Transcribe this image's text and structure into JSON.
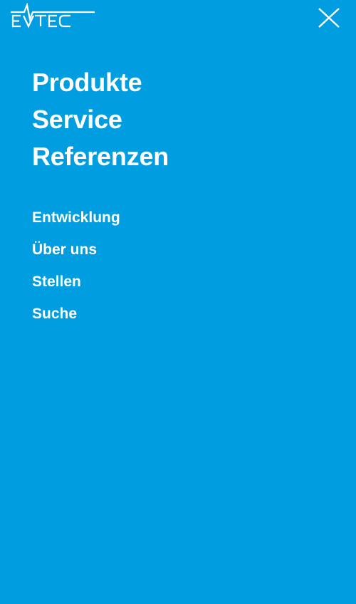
{
  "brand": {
    "logo_text": "EVTEC",
    "logo_icon": "evtec-logo"
  },
  "header": {
    "close_icon": "close-icon"
  },
  "menu": {
    "primary": [
      {
        "label": "Produkte"
      },
      {
        "label": "Service"
      },
      {
        "label": "Referenzen"
      }
    ],
    "secondary": [
      {
        "label": "Entwicklung"
      },
      {
        "label": "Über uns"
      },
      {
        "label": "Stellen"
      },
      {
        "label": "Suche"
      }
    ]
  },
  "colors": {
    "background": "#009ee0",
    "text": "#ffffff"
  }
}
